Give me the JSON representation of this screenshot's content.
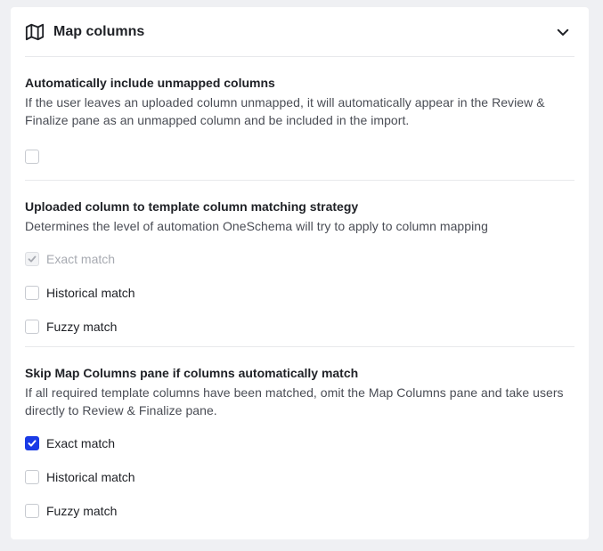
{
  "header": {
    "title": "Map columns",
    "icon": "map-icon",
    "collapse_icon": "chevron-down-icon"
  },
  "sections": [
    {
      "title": "Automatically include unmapped columns",
      "description": "If the user leaves an uploaded column unmapped, it will automatically appear in the Review & Finalize pane as an unmapped column and be included in the import.",
      "options": [
        {
          "label": "",
          "checked": false,
          "disabled": false
        }
      ]
    },
    {
      "title": "Uploaded column to template column matching strategy",
      "description": "Determines the level of automation OneSchema will try to apply to column mapping",
      "options": [
        {
          "label": "Exact match",
          "checked": true,
          "disabled": true
        },
        {
          "label": "Historical match",
          "checked": false,
          "disabled": false
        },
        {
          "label": "Fuzzy match",
          "checked": false,
          "disabled": false
        }
      ]
    },
    {
      "title": "Skip Map Columns pane if columns automatically match",
      "description": "If all required template columns have been matched, omit the Map Columns pane and take users directly to Review & Finalize pane.",
      "options": [
        {
          "label": "Exact match",
          "checked": true,
          "disabled": false
        },
        {
          "label": "Historical match",
          "checked": false,
          "disabled": false
        },
        {
          "label": "Fuzzy match",
          "checked": false,
          "disabled": false
        }
      ]
    }
  ],
  "colors": {
    "accent": "#1a3be6",
    "disabled_check": "#a7aab1",
    "background": "#eff0f3"
  }
}
